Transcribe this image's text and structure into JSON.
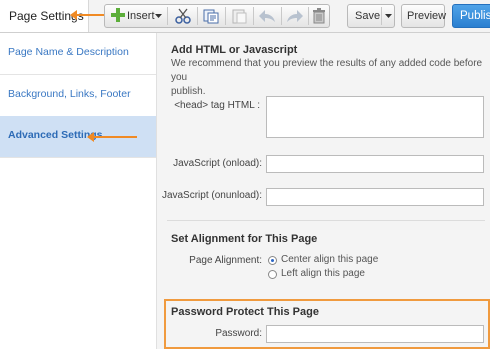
{
  "toolbar": {
    "page_settings_tab": "Page Settings",
    "insert_label": "Insert",
    "save_label": "Save",
    "preview_label": "Preview",
    "publish_label": "Publish"
  },
  "sidebar": {
    "items": [
      {
        "label": "Page Name & Description"
      },
      {
        "label": "Background, Links, Footer"
      },
      {
        "label": "Advanced Settings"
      }
    ]
  },
  "main": {
    "html_section": {
      "title": "Add HTML or Javascript",
      "description_line1": "We recommend that you preview the results of any added code before you",
      "description_line2": "publish.",
      "head_label": "<head> tag HTML :",
      "onload_label": "JavaScript (onload):",
      "onunload_label": "JavaScript (onunload):"
    },
    "alignment": {
      "title": "Set Alignment for This Page",
      "label": "Page Alignment:",
      "options": [
        "Center align this page",
        "Left align this page"
      ],
      "selected": "Center align this page"
    },
    "password": {
      "title": "Password Protect This Page",
      "label": "Password:"
    }
  },
  "colors": {
    "accent_orange": "#f08a24",
    "publish_blue": "#2a7fd0",
    "sidebar_active": "#cfe0f4"
  }
}
